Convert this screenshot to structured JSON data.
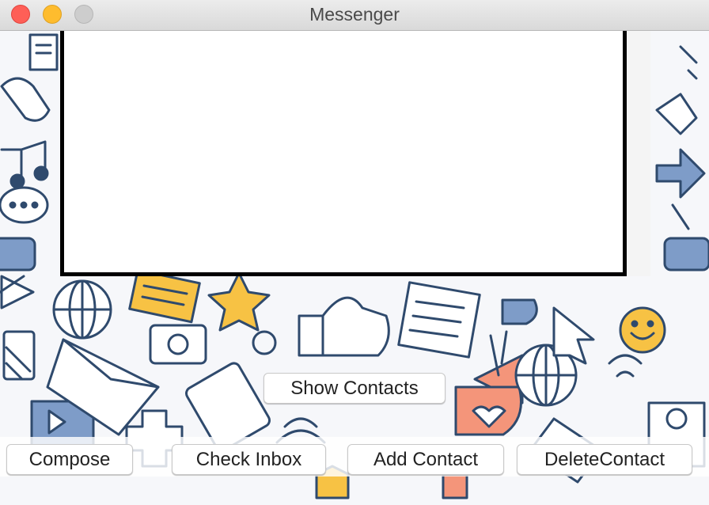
{
  "window": {
    "title": "Messenger"
  },
  "buttons": {
    "show_contacts": "Show Contacts",
    "compose": "Compose",
    "check_inbox": "Check Inbox",
    "add_contact": "Add Contact",
    "delete_contact": "DeleteContact"
  },
  "colors": {
    "doodle_blue": "#7e9cc8",
    "doodle_orange": "#f4957a",
    "doodle_yellow": "#f7c244",
    "doodle_outline": "#2f4a6d"
  }
}
